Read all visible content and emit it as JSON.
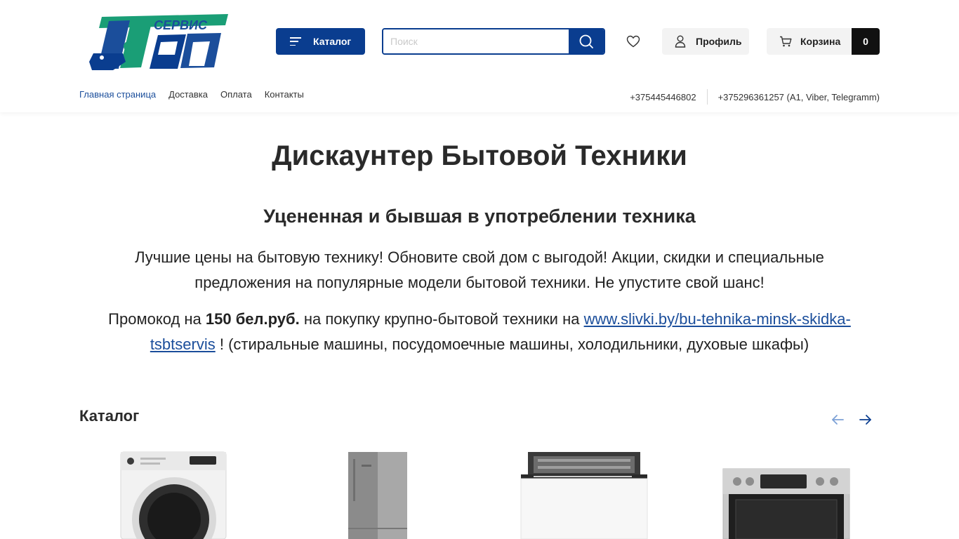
{
  "header": {
    "logo_text_top": "СЕРВИС",
    "logo_text_main": "ЦБТ",
    "catalog_label": "Каталог",
    "search_placeholder": "Поиск",
    "profile_label": "Профиль",
    "cart_label": "Корзина",
    "cart_count": "0"
  },
  "nav": {
    "items": [
      "Главная страница",
      "Доставка",
      "Оплата",
      "Контакты"
    ]
  },
  "phones": {
    "phone1": "+375445446802",
    "phone2": "+375296361257 (A1, Viber, Telegramm)"
  },
  "hero": {
    "title": "Дискаунтер Бытовой Техники",
    "subtitle": "Уцененная и бывшая в употреблении техника",
    "text": "Лучшие цены на бытовую технику! Обновите свой дом с выгодой! Акции, скидки и специальные предложения на популярные модели бытовой техники. Не упустите свой шанс!",
    "promo_prefix": "Промокод на ",
    "promo_amount": "150 бел.руб.",
    "promo_middle": " на покупку крупно-бытовой техники на ",
    "promo_link": "www.slivki.by/bu-tehnika-minsk-skidka-tsbtservis",
    "promo_suffix": " ! (стиральные машины, посудомоечные машины, холодильники, духовые шкафы)"
  },
  "catalog_section": {
    "title": "Каталог",
    "products": [
      "washing-machine",
      "refrigerator",
      "dishwasher",
      "oven"
    ]
  },
  "colors": {
    "brand_blue": "#0a3d8f",
    "link_blue": "#1b4e9b",
    "logo_green": "#1a9e76"
  }
}
